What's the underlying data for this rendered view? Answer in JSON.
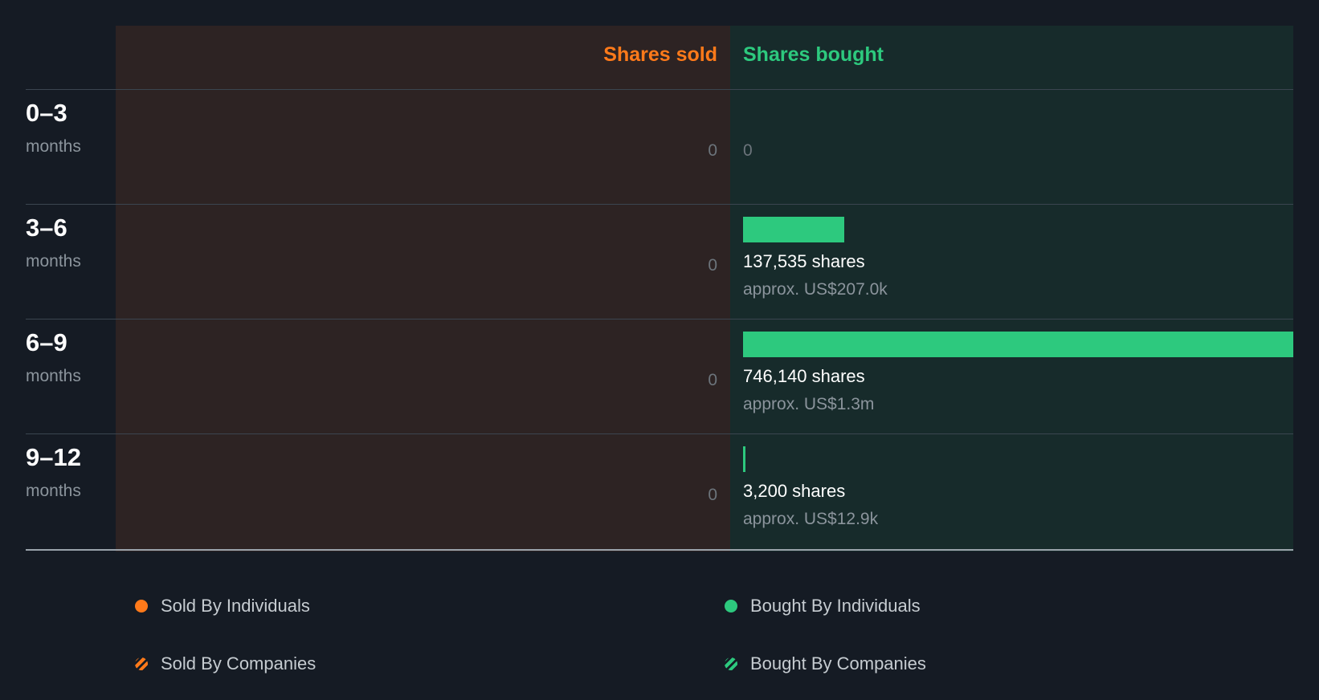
{
  "colors": {
    "sold": "#ff7a1a",
    "bought": "#2dc97e",
    "muted": "#6c747b"
  },
  "chart_data": {
    "type": "bar",
    "orientation": "horizontal-diverging",
    "headers": {
      "sold": "Shares sold",
      "bought": "Shares bought"
    },
    "periods": [
      {
        "label": "0–3",
        "unit": "months",
        "sold": 0,
        "bought": 0,
        "sold_label": "0",
        "bought_label": "0",
        "bought_shares_text": "",
        "bought_value_text": ""
      },
      {
        "label": "3–6",
        "unit": "months",
        "sold": 0,
        "bought": 137535,
        "sold_label": "0",
        "bought_label": "",
        "bought_shares_text": "137,535 shares",
        "bought_value_text": "approx. US$207.0k"
      },
      {
        "label": "6–9",
        "unit": "months",
        "sold": 0,
        "bought": 746140,
        "sold_label": "0",
        "bought_label": "",
        "bought_shares_text": "746,140 shares",
        "bought_value_text": "approx. US$1.3m"
      },
      {
        "label": "9–12",
        "unit": "months",
        "sold": 0,
        "bought": 3200,
        "sold_label": "0",
        "bought_label": "",
        "bought_shares_text": "3,200 shares",
        "bought_value_text": "approx. US$12.9k"
      }
    ],
    "max_value": 746140
  },
  "legend": [
    {
      "label": "Sold By Individuals",
      "kind": "sold",
      "style": "solid"
    },
    {
      "label": "Bought By Individuals",
      "kind": "bought",
      "style": "solid"
    },
    {
      "label": "Sold By Companies",
      "kind": "sold",
      "style": "striped"
    },
    {
      "label": "Bought By Companies",
      "kind": "bought",
      "style": "striped"
    }
  ]
}
